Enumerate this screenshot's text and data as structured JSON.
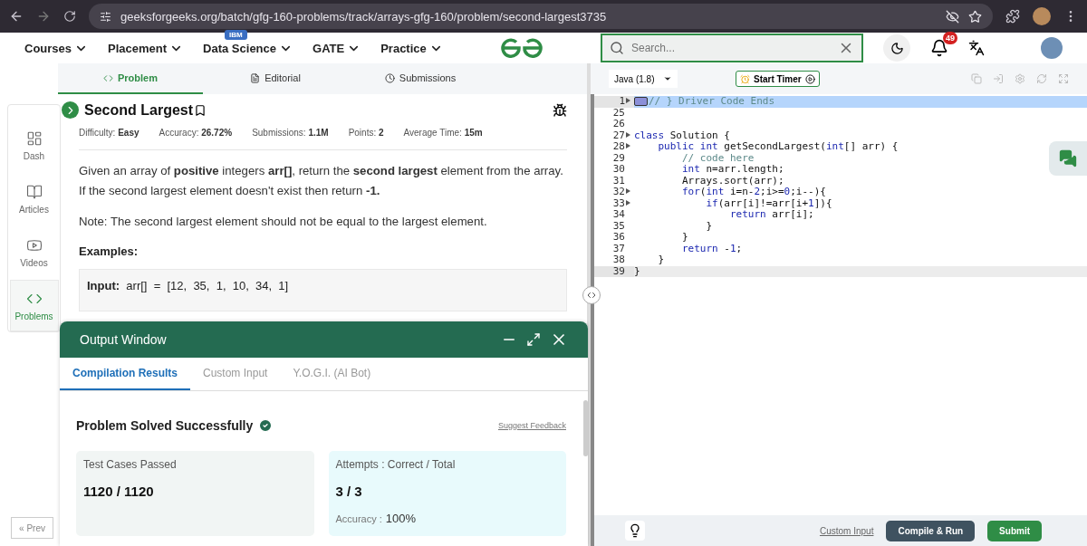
{
  "browser": {
    "url": "geeksforgeeks.org/batch/gfg-160-problems/track/arrays-gfg-160/problem/second-largest3735"
  },
  "nav": {
    "items": [
      {
        "label": "Courses"
      },
      {
        "label": "Placement"
      },
      {
        "label": "Data Science",
        "badge": "IBM"
      },
      {
        "label": "GATE"
      },
      {
        "label": "Practice"
      }
    ],
    "search": {
      "placeholder": "Search..."
    },
    "notifications": "49"
  },
  "sidebar": {
    "items": [
      {
        "label": "Dash",
        "selected": false
      },
      {
        "label": "Articles",
        "selected": false
      },
      {
        "label": "Videos",
        "selected": false
      },
      {
        "label": "Problems",
        "selected": true
      }
    ],
    "prev": "« Prev"
  },
  "tabs": [
    {
      "label": "Problem",
      "selected": true
    },
    {
      "label": "Editorial",
      "selected": false
    },
    {
      "label": "Submissions",
      "selected": false
    }
  ],
  "problem": {
    "title": "Second Largest",
    "meta": [
      {
        "label": "Difficulty:",
        "value": "Easy"
      },
      {
        "label": "Accuracy:",
        "value": "26.72%"
      },
      {
        "label": "Submissions:",
        "value": "1.1M"
      },
      {
        "label": "Points:",
        "value": "2"
      },
      {
        "label": "Average Time:",
        "value": "15m"
      }
    ],
    "paragraphs": [
      "Given an array of **positive** integers **arr[]**, return the **second largest** element from the array. If the second largest element doesn't exist then return **-1.**",
      "Note: The second largest element should not be equal to the largest element."
    ],
    "examples_heading": "Examples:",
    "example": "**Input:**  arr[]  =  [12,  35,  1,  10,  34,  1]"
  },
  "output_window": {
    "title": "Output Window",
    "tabs": [
      {
        "label": "Compilation Results",
        "selected": true
      },
      {
        "label": "Custom Input",
        "selected": false
      },
      {
        "label": "Y.O.G.I. (AI Bot)",
        "selected": false
      }
    ],
    "status": "Problem Solved Successfully",
    "feedback": "Suggest Feedback",
    "cards": [
      {
        "title": "Test Cases Passed",
        "value": "1120 / 1120",
        "color": "#f1f5f4"
      },
      {
        "title": "Attempts : Correct / Total",
        "value": "3 / 3",
        "note_label": "Accuracy :",
        "note_value": "100%",
        "color": "#e8fafc"
      }
    ]
  },
  "editor": {
    "language": "Java (1.8)",
    "timer": "Start Timer",
    "lines": [
      {
        "number": "1",
        "fold": true,
        "selected": true,
        "active": false,
        "tokens": [
          {
            "kind": "comment",
            "text": "// } Driver Code Ends"
          }
        ]
      },
      {
        "number": "25",
        "fold": false,
        "selected": false,
        "active": false
      },
      {
        "number": "26",
        "fold": false,
        "selected": false,
        "active": false
      },
      {
        "number": "27",
        "fold": true,
        "selected": false,
        "active": false,
        "tokens": [
          {
            "kind": "keyword",
            "text": "class"
          },
          {
            "kind": "plain",
            "text": " Solution {"
          }
        ]
      },
      {
        "number": "28",
        "fold": true,
        "selected": false,
        "active": false,
        "tokens": [
          {
            "kind": "keyword",
            "text": "    public int"
          },
          {
            "kind": "plain",
            "text": " getSecondLargest("
          },
          {
            "kind": "keyword",
            "text": "int"
          },
          {
            "kind": "plain",
            "text": "[] arr) {"
          }
        ]
      },
      {
        "number": "29",
        "fold": false,
        "selected": false,
        "active": false,
        "tokens": [
          {
            "kind": "comment",
            "text": "        // code here"
          }
        ]
      },
      {
        "number": "30",
        "fold": false,
        "selected": false,
        "active": false,
        "tokens": [
          {
            "kind": "keyword",
            "text": "        int"
          },
          {
            "kind": "plain",
            "text": " n=arr.length;"
          }
        ]
      },
      {
        "number": "31",
        "fold": false,
        "selected": false,
        "active": false,
        "tokens": [
          {
            "kind": "plain",
            "text": "        Arrays.sort(arr);"
          }
        ]
      },
      {
        "number": "32",
        "fold": true,
        "selected": false,
        "active": false,
        "tokens": [
          {
            "kind": "keyword",
            "text": "        for"
          },
          {
            "kind": "plain",
            "text": "("
          },
          {
            "kind": "keyword",
            "text": "int"
          },
          {
            "kind": "plain",
            "text": " i=n-"
          },
          {
            "kind": "number",
            "text": "2"
          },
          {
            "kind": "plain",
            "text": ";i>="
          },
          {
            "kind": "number",
            "text": "0"
          },
          {
            "kind": "plain",
            "text": ";i--){"
          }
        ]
      },
      {
        "number": "33",
        "fold": true,
        "selected": false,
        "active": false,
        "tokens": [
          {
            "kind": "keyword",
            "text": "            if"
          },
          {
            "kind": "plain",
            "text": "(arr[i]!=arr[i+"
          },
          {
            "kind": "number",
            "text": "1"
          },
          {
            "kind": "plain",
            "text": "]){"
          }
        ]
      },
      {
        "number": "34",
        "fold": false,
        "selected": false,
        "active": false,
        "tokens": [
          {
            "kind": "keyword",
            "text": "                return"
          },
          {
            "kind": "plain",
            "text": " arr[i];"
          }
        ]
      },
      {
        "number": "35",
        "fold": false,
        "selected": false,
        "active": false,
        "tokens": [
          {
            "kind": "plain",
            "text": "            }"
          }
        ]
      },
      {
        "number": "36",
        "fold": false,
        "selected": false,
        "active": false,
        "tokens": [
          {
            "kind": "plain",
            "text": "        }"
          }
        ]
      },
      {
        "number": "37",
        "fold": false,
        "selected": false,
        "active": false,
        "tokens": [
          {
            "kind": "keyword",
            "text": "        return"
          },
          {
            "kind": "plain",
            "text": " -"
          },
          {
            "kind": "number",
            "text": "1"
          },
          {
            "kind": "plain",
            "text": ";"
          }
        ]
      },
      {
        "number": "38",
        "fold": false,
        "selected": false,
        "active": false,
        "tokens": [
          {
            "kind": "plain",
            "text": "    }"
          }
        ]
      },
      {
        "number": "39",
        "fold": false,
        "selected": false,
        "active": true,
        "tokens": [
          {
            "kind": "plain",
            "text": "}"
          }
        ]
      }
    ],
    "custom_input": "Custom Input",
    "compile": "Compile & Run",
    "submit": "Submit"
  }
}
